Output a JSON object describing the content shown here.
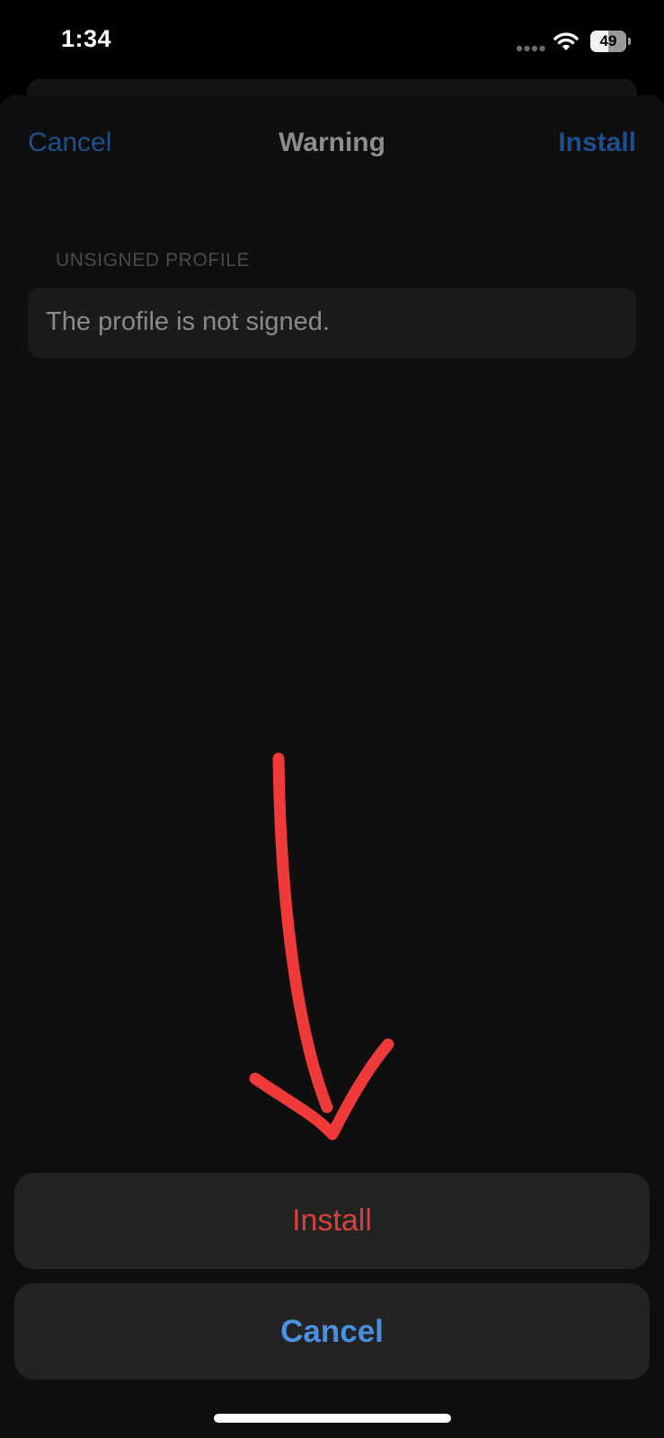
{
  "status_bar": {
    "time": "1:34",
    "battery_level": "49",
    "battery_fraction": 0.49,
    "icons": [
      "signal-dots-icon",
      "wifi-icon",
      "battery-icon"
    ]
  },
  "nav": {
    "cancel_label": "Cancel",
    "title": "Warning",
    "install_label": "Install"
  },
  "section": {
    "header": "UNSIGNED PROFILE",
    "message": "The profile is not signed."
  },
  "action_sheet": {
    "install_label": "Install",
    "cancel_label": "Cancel"
  },
  "colors": {
    "destructive": "#d8413b",
    "accent": "#4a90e2",
    "dimmed_accent": "#1b4f8f",
    "annotation": "#f03a3a"
  }
}
